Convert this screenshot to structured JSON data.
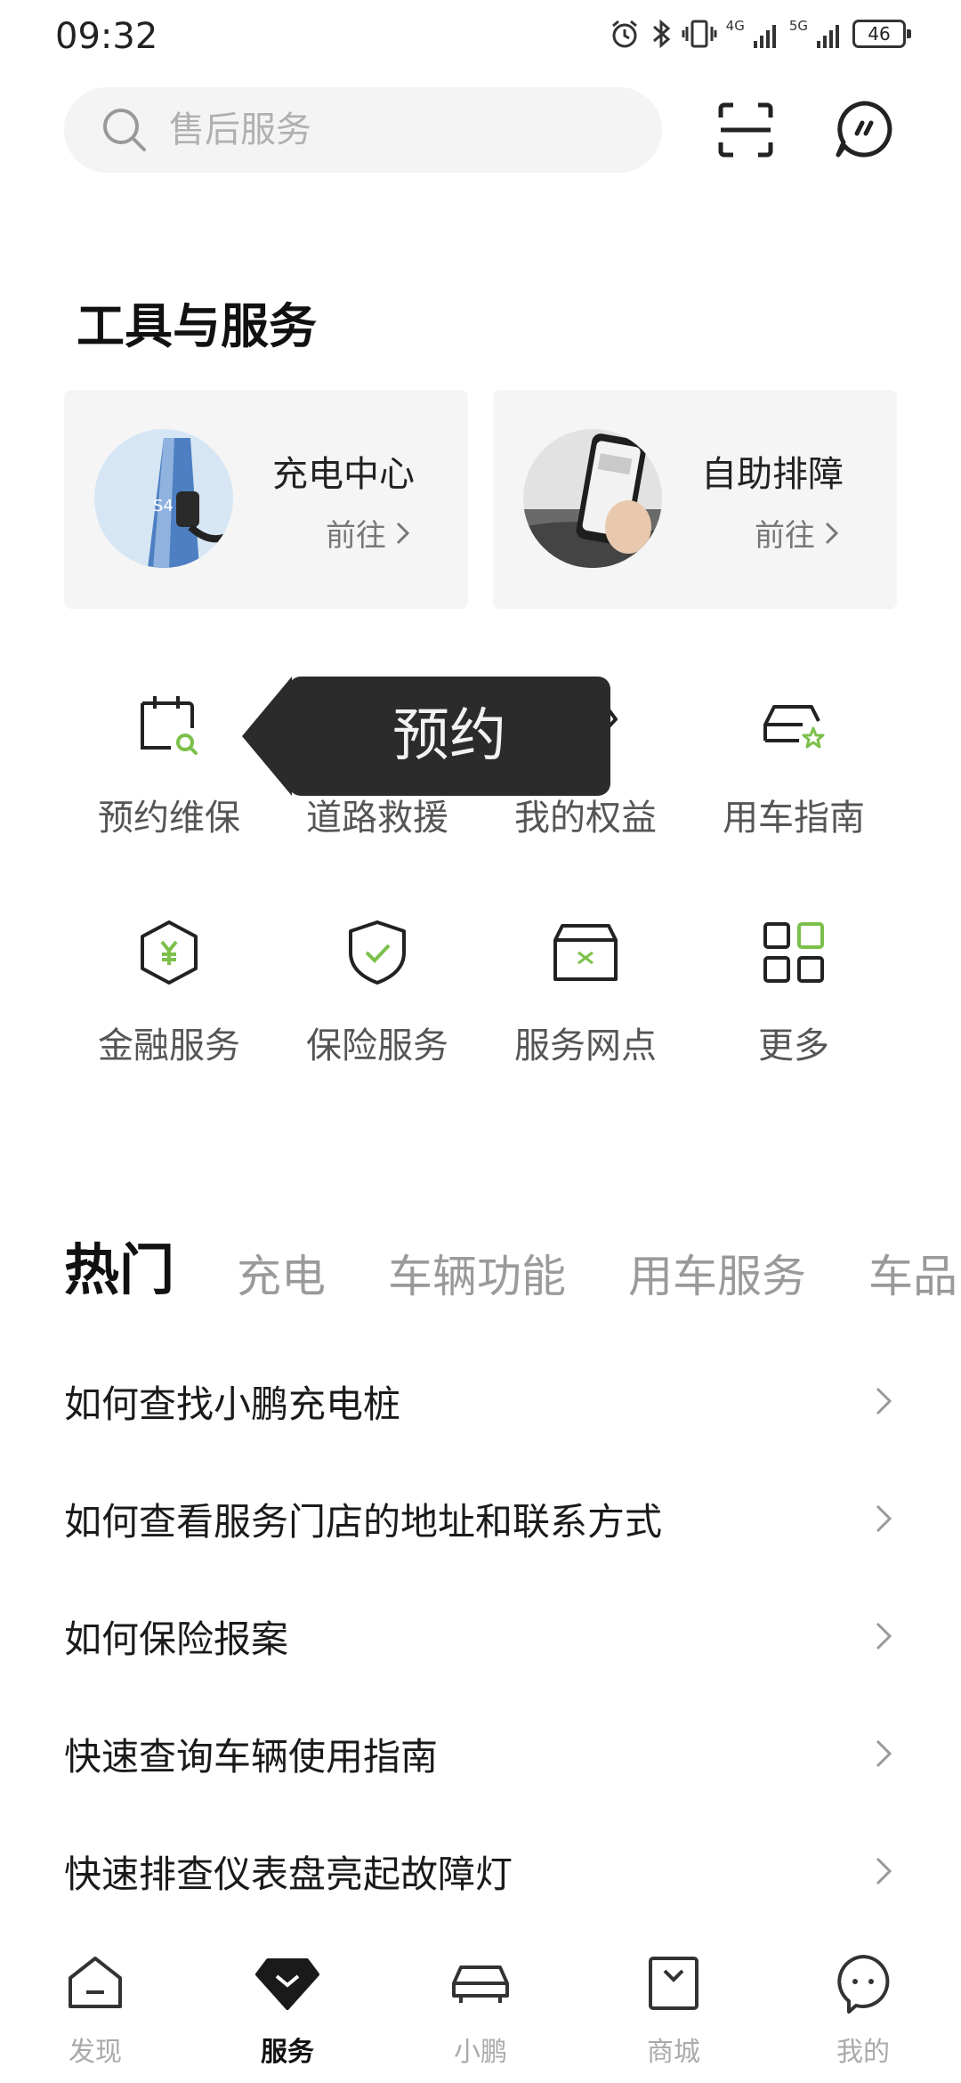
{
  "status_bar": {
    "time": "09:32",
    "network_1": "4G",
    "network_2": "5G",
    "battery": "46"
  },
  "search": {
    "placeholder": "售后服务"
  },
  "section_title": "工具与服务",
  "cards": [
    {
      "title": "充电中心",
      "action": "前往"
    },
    {
      "title": "自助排障",
      "action": "前往"
    }
  ],
  "grid": [
    {
      "label": "预约维保",
      "icon": "calendar-search-icon"
    },
    {
      "label": "道路救援",
      "icon": "tow-truck-icon"
    },
    {
      "label": "我的权益",
      "icon": "diamond-icon"
    },
    {
      "label": "用车指南",
      "icon": "car-star-icon"
    },
    {
      "label": "金融服务",
      "icon": "yuan-hexagon-icon"
    },
    {
      "label": "保险服务",
      "icon": "shield-check-icon"
    },
    {
      "label": "服务网点",
      "icon": "store-icon"
    },
    {
      "label": "更多",
      "icon": "grid-icon"
    }
  ],
  "tooltip": {
    "text": "预约"
  },
  "tabs": [
    "热门",
    "充电",
    "车辆功能",
    "用车服务",
    "车品"
  ],
  "faq": [
    "如何查找小鹏充电桩",
    "如何查看服务门店的地址和联系方式",
    "如何保险报案",
    "快速查询车辆使用指南",
    "快速排查仪表盘亮起故障灯"
  ],
  "bottom_nav": [
    {
      "label": "发现",
      "icon": "home-icon"
    },
    {
      "label": "服务",
      "icon": "service-icon",
      "active": true
    },
    {
      "label": "小鹏",
      "icon": "car-icon"
    },
    {
      "label": "商城",
      "icon": "shopping-bag-icon"
    },
    {
      "label": "我的",
      "icon": "profile-face-icon"
    }
  ],
  "colors": {
    "accent_green": "#7cc04b",
    "tooltip_bg": "#2b2b2b"
  }
}
